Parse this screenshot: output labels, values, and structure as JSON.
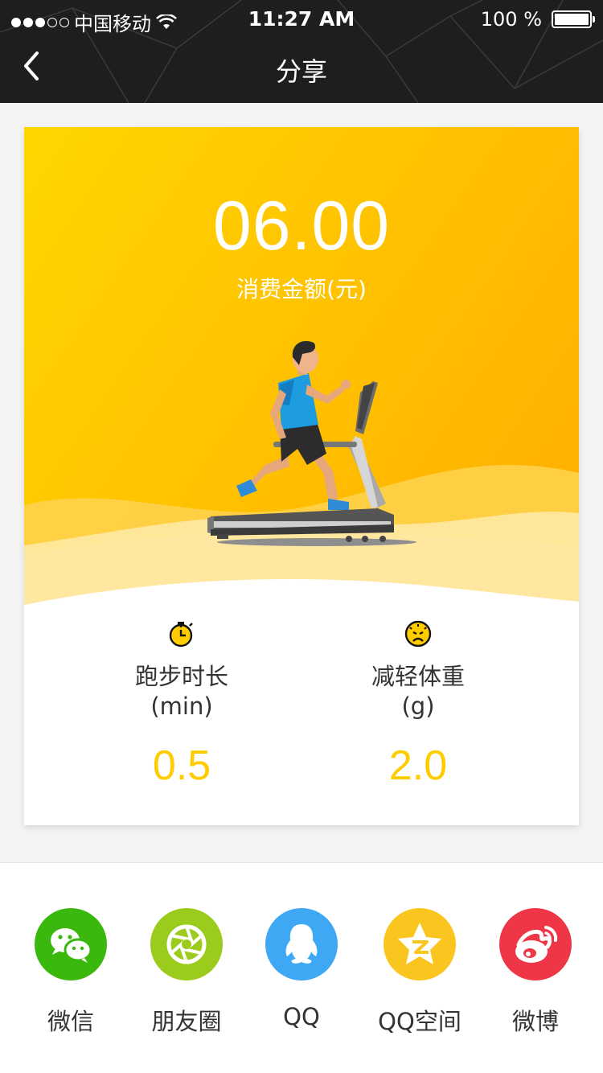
{
  "status_bar": {
    "carrier": "中国移动",
    "time": "11:27 AM",
    "battery": "100 %",
    "signal_bars_filled": 3,
    "signal_bars_total": 5
  },
  "nav": {
    "title": "分享",
    "back_icon": "chevron-left-icon"
  },
  "summary": {
    "amount": "06.00",
    "amount_label": "消费金额(元)"
  },
  "stats": [
    {
      "icon": "stopwatch-icon",
      "name": "跑步时长",
      "unit": "(min)",
      "value": "0.5"
    },
    {
      "icon": "sad-gauge-icon",
      "name": "减轻体重",
      "unit": "(g)",
      "value": "2.0"
    }
  ],
  "share": [
    {
      "icon": "wechat-icon",
      "label": "微信",
      "color": "#3bb80e"
    },
    {
      "icon": "moments-icon",
      "label": "朋友圈",
      "color": "#9bcc1d"
    },
    {
      "icon": "qq-icon",
      "label": "QQ",
      "color": "#3ea8f4"
    },
    {
      "icon": "qzone-icon",
      "label": "QQ空间",
      "color": "#fbc520"
    },
    {
      "icon": "weibo-icon",
      "label": "微博",
      "color": "#ee3646"
    }
  ],
  "colors": {
    "accent": "#ffcc00",
    "nav_bg": "#1e1e1e",
    "hero_gradient_start": "#ffd400",
    "hero_gradient_end": "#ffb300"
  }
}
